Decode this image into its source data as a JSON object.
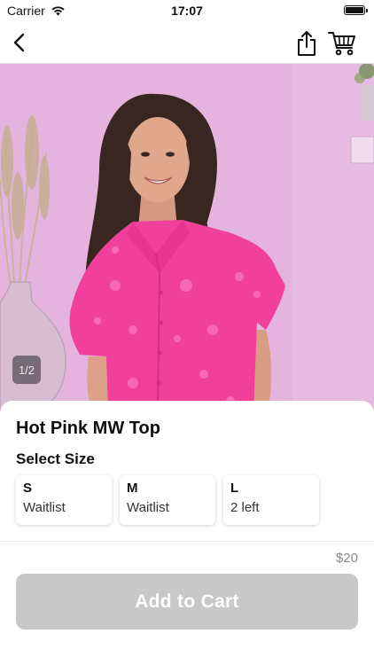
{
  "status_bar": {
    "carrier": "Carrier",
    "time": "17:07"
  },
  "nav": {
    "back_icon": "chevron-left-icon",
    "share_icon": "share-icon",
    "cart_icon": "cart-icon"
  },
  "gallery": {
    "page_indicator": "1/2"
  },
  "product": {
    "title": "Hot Pink MW Top",
    "size_heading": "Select Size",
    "sizes": [
      {
        "name": "S",
        "status": "Waitlist"
      },
      {
        "name": "M",
        "status": "Waitlist"
      },
      {
        "name": "L",
        "status": "2 left"
      }
    ],
    "price": "$20"
  },
  "footer": {
    "add_to_cart_label": "Add to Cart"
  },
  "colors": {
    "button_disabled": "#c8c8c8",
    "backdrop_pink": "#e2b0db",
    "shirt_pink": "#f0409c"
  }
}
